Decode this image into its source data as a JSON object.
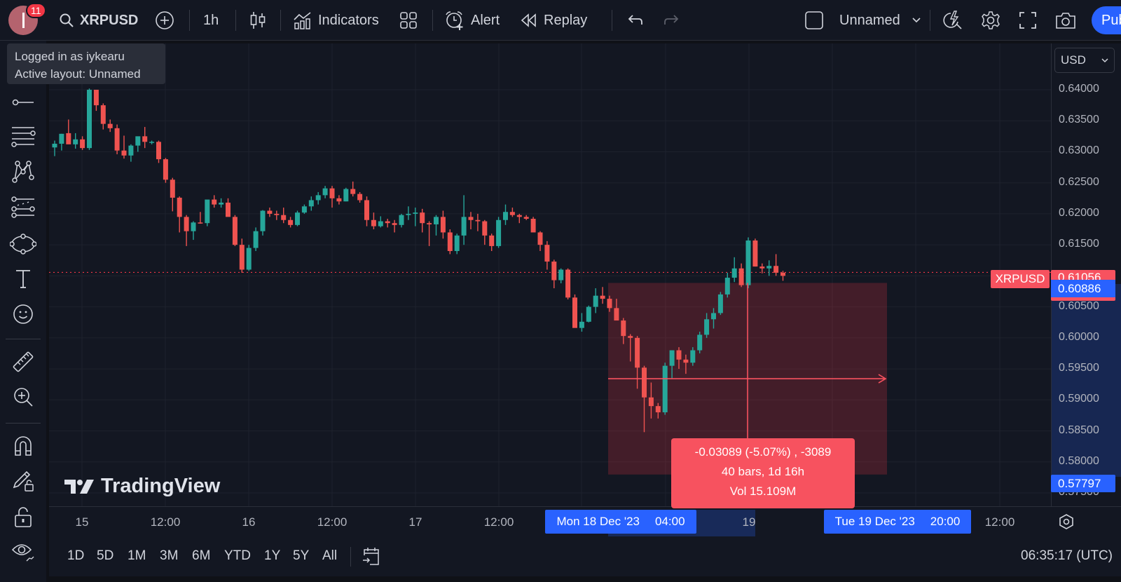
{
  "topbar": {
    "notification_count": "11",
    "symbol": "XRPUSD",
    "interval": "1h",
    "indicators_label": "Indicators",
    "alert_label": "Alert",
    "replay_label": "Replay",
    "layout_name": "Unnamed",
    "publish_label": "Publish"
  },
  "tooltip": {
    "line1": "Logged in as iykearu",
    "line2": "Active layout: Unnamed"
  },
  "price_axis": {
    "currency": "USD",
    "labels": [
      "0.64000",
      "0.63500",
      "0.63000",
      "0.62500",
      "0.62000",
      "0.61500",
      "0.60500",
      "0.60000",
      "0.59500",
      "0.59000",
      "0.58500",
      "0.58000",
      "0.57500"
    ],
    "symbol_tag": "XRPUSD",
    "last_price": "0.61056",
    "range_high": "0.60886",
    "range_low": "0.57797"
  },
  "time_axis": {
    "labels": [
      "15",
      "12:00",
      "16",
      "12:00",
      "17",
      "12:00",
      "19",
      "12:00"
    ],
    "range_start": {
      "date": "Mon 18 Dec '23",
      "time": "04:00"
    },
    "range_end": {
      "date": "Tue 19 Dec '23",
      "time": "20:00"
    }
  },
  "measure": {
    "change": "-0.03089 (-5.07%) , -3089",
    "bars": "40 bars, 1d 16h",
    "volume": "Vol 15.109M"
  },
  "bottombar": {
    "ranges": [
      "1D",
      "5D",
      "1M",
      "3M",
      "6M",
      "YTD",
      "1Y",
      "5Y",
      "All"
    ],
    "clock": "06:35:17 (UTC)"
  },
  "watermark": "TradingView",
  "colors": {
    "up": "#26a69a",
    "down": "#ef5350",
    "accent": "#2962ff",
    "measure": "#f7525f"
  },
  "chart_data": {
    "type": "candlestick",
    "symbol": "XRPUSD",
    "interval": "1h",
    "ylim": [
      0.575,
      0.643
    ],
    "y_ticks": [
      0.64,
      0.635,
      0.63,
      0.625,
      0.62,
      0.615,
      0.61,
      0.605,
      0.6,
      0.595,
      0.59,
      0.585,
      0.58,
      0.575
    ],
    "last_price": 0.61056,
    "measure_range": {
      "from_price": 0.60886,
      "to_price": 0.57797,
      "change": -0.03089,
      "change_pct": -5.07,
      "bars": 40
    },
    "candles": [
      [
        0.6307,
        0.6318,
        0.6293,
        0.6313
      ],
      [
        0.6313,
        0.6329,
        0.6302,
        0.6329
      ],
      [
        0.633,
        0.6352,
        0.632,
        0.6312
      ],
      [
        0.6312,
        0.633,
        0.6305,
        0.632
      ],
      [
        0.632,
        0.6325,
        0.6303,
        0.6306
      ],
      [
        0.6306,
        0.6402,
        0.6303,
        0.64
      ],
      [
        0.64,
        0.64,
        0.6366,
        0.6375
      ],
      [
        0.6375,
        0.6378,
        0.6336,
        0.6345
      ],
      [
        0.6345,
        0.6352,
        0.6332,
        0.6338
      ],
      [
        0.6338,
        0.6344,
        0.6296,
        0.6302
      ],
      [
        0.6302,
        0.6326,
        0.6289,
        0.6294
      ],
      [
        0.6294,
        0.6312,
        0.6284,
        0.631
      ],
      [
        0.631,
        0.6322,
        0.63,
        0.6325
      ],
      [
        0.6325,
        0.634,
        0.6306,
        0.6316
      ],
      [
        0.6316,
        0.6318,
        0.6312,
        0.6316
      ],
      [
        0.6316,
        0.6318,
        0.6282,
        0.6288
      ],
      [
        0.6288,
        0.629,
        0.625,
        0.6255
      ],
      [
        0.6255,
        0.6258,
        0.6204,
        0.6226
      ],
      [
        0.6226,
        0.6228,
        0.617,
        0.6195
      ],
      [
        0.6195,
        0.6198,
        0.6148,
        0.6172
      ],
      [
        0.6172,
        0.6188,
        0.6158,
        0.6186
      ],
      [
        0.6186,
        0.6203,
        0.6184,
        0.6185
      ],
      [
        0.6185,
        0.6195,
        0.618,
        0.6223
      ],
      [
        0.6223,
        0.623,
        0.621,
        0.6215
      ],
      [
        0.6215,
        0.6225,
        0.621,
        0.6218
      ],
      [
        0.6218,
        0.6225,
        0.62,
        0.6195
      ],
      [
        0.6195,
        0.6198,
        0.6148,
        0.615
      ],
      [
        0.615,
        0.616,
        0.6105,
        0.611
      ],
      [
        0.611,
        0.615,
        0.6108,
        0.6145
      ],
      [
        0.6145,
        0.6178,
        0.614,
        0.6172
      ],
      [
        0.6172,
        0.6206,
        0.6165,
        0.6205
      ],
      [
        0.6205,
        0.621,
        0.6195,
        0.62
      ],
      [
        0.62,
        0.6205,
        0.619,
        0.6198
      ],
      [
        0.6198,
        0.621,
        0.6185,
        0.619
      ],
      [
        0.619,
        0.6195,
        0.6178,
        0.6182
      ],
      [
        0.6182,
        0.6205,
        0.618,
        0.6202
      ],
      [
        0.6202,
        0.6215,
        0.62,
        0.6212
      ],
      [
        0.6212,
        0.6228,
        0.6205,
        0.6222
      ],
      [
        0.6222,
        0.6235,
        0.6215,
        0.623
      ],
      [
        0.623,
        0.6245,
        0.6225,
        0.6241
      ],
      [
        0.6241,
        0.6245,
        0.621,
        0.6225
      ],
      [
        0.6225,
        0.623,
        0.6215,
        0.622
      ],
      [
        0.622,
        0.6242,
        0.622,
        0.624
      ],
      [
        0.624,
        0.6252,
        0.6228,
        0.6232
      ],
      [
        0.6232,
        0.6235,
        0.6218,
        0.6222
      ],
      [
        0.6222,
        0.6228,
        0.618,
        0.619
      ],
      [
        0.619,
        0.6202,
        0.6175,
        0.618
      ],
      [
        0.618,
        0.6196,
        0.6178,
        0.6188
      ],
      [
        0.6188,
        0.6192,
        0.6178,
        0.6185
      ],
      [
        0.6185,
        0.619,
        0.617,
        0.6182
      ],
      [
        0.6182,
        0.62,
        0.6178,
        0.6198
      ],
      [
        0.6198,
        0.6212,
        0.619,
        0.62
      ],
      [
        0.62,
        0.621,
        0.618,
        0.6202
      ],
      [
        0.6202,
        0.6208,
        0.617,
        0.6185
      ],
      [
        0.6185,
        0.6188,
        0.6148,
        0.6183
      ],
      [
        0.6183,
        0.6198,
        0.6165,
        0.6195
      ],
      [
        0.6195,
        0.6205,
        0.616,
        0.617
      ],
      [
        0.617,
        0.6175,
        0.6135,
        0.614
      ],
      [
        0.614,
        0.6168,
        0.6135,
        0.6165
      ],
      [
        0.6165,
        0.623,
        0.615,
        0.6195
      ],
      [
        0.6195,
        0.6203,
        0.6175,
        0.619
      ],
      [
        0.619,
        0.62,
        0.6172,
        0.6188
      ],
      [
        0.6188,
        0.619,
        0.615,
        0.6165
      ],
      [
        0.6165,
        0.6168,
        0.614,
        0.6148
      ],
      [
        0.6148,
        0.6195,
        0.6145,
        0.619
      ],
      [
        0.619,
        0.6215,
        0.6182,
        0.6203
      ],
      [
        0.6203,
        0.621,
        0.6195,
        0.6198
      ],
      [
        0.6198,
        0.62,
        0.6185,
        0.6195
      ],
      [
        0.6195,
        0.6198,
        0.619,
        0.6192
      ],
      [
        0.6192,
        0.6195,
        0.6175,
        0.617
      ],
      [
        0.617,
        0.6172,
        0.614,
        0.615
      ],
      [
        0.615,
        0.6156,
        0.611,
        0.6123
      ],
      [
        0.6123,
        0.6126,
        0.608,
        0.6093
      ],
      [
        0.6093,
        0.6112,
        0.6088,
        0.611
      ],
      [
        0.611,
        0.6112,
        0.6062,
        0.6065
      ],
      [
        0.6065,
        0.607,
        0.602,
        0.6016
      ],
      [
        0.6016,
        0.604,
        0.601,
        0.6026
      ],
      [
        0.6026,
        0.6052,
        0.6025,
        0.605
      ],
      [
        0.605,
        0.608,
        0.604,
        0.6068
      ],
      [
        0.6068,
        0.6082,
        0.6055,
        0.6063
      ],
      [
        0.6063,
        0.6068,
        0.6042,
        0.6048
      ],
      [
        0.6048,
        0.6063,
        0.603,
        0.6028
      ],
      [
        0.6028,
        0.6032,
        0.599,
        0.6003
      ],
      [
        0.6003,
        0.6006,
        0.5962,
        0.6
      ],
      [
        0.6,
        0.6003,
        0.5918,
        0.5952
      ],
      [
        0.5952,
        0.5955,
        0.5848,
        0.5904
      ],
      [
        0.5904,
        0.5928,
        0.587,
        0.589
      ],
      [
        0.589,
        0.5895,
        0.587,
        0.588
      ],
      [
        0.588,
        0.596,
        0.5876,
        0.5955
      ],
      [
        0.5955,
        0.598,
        0.5935,
        0.598
      ],
      [
        0.598,
        0.5985,
        0.595,
        0.5965
      ],
      [
        0.5965,
        0.5973,
        0.5942,
        0.596
      ],
      [
        0.596,
        0.5985,
        0.5955,
        0.598
      ],
      [
        0.598,
        0.601,
        0.5975,
        0.6005
      ],
      [
        0.6005,
        0.604,
        0.6,
        0.603
      ],
      [
        0.603,
        0.6048,
        0.6015,
        0.604
      ],
      [
        0.604,
        0.6074,
        0.6037,
        0.607
      ],
      [
        0.607,
        0.6105,
        0.6065,
        0.6097
      ],
      [
        0.6097,
        0.613,
        0.609,
        0.6112
      ],
      [
        0.6112,
        0.612,
        0.6082,
        0.6085
      ],
      [
        0.6085,
        0.6162,
        0.608,
        0.6157
      ],
      [
        0.6157,
        0.616,
        0.6115,
        0.6115
      ],
      [
        0.6115,
        0.612,
        0.6104,
        0.6112
      ],
      [
        0.6112,
        0.6125,
        0.61,
        0.6116
      ],
      [
        0.6116,
        0.6135,
        0.61,
        0.6105
      ],
      [
        0.6105,
        0.6108,
        0.6092,
        0.61
      ]
    ]
  }
}
